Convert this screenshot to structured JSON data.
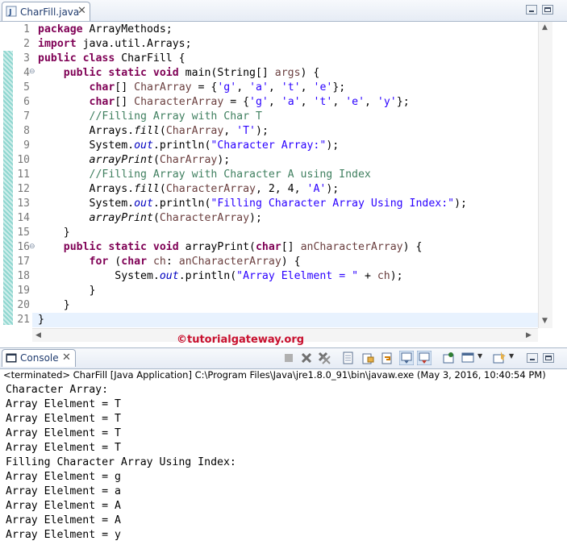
{
  "editor": {
    "tab_label": "CharFill.java",
    "tab_close": "✕",
    "lines": [
      {
        "n": "1",
        "html": "<span class=\"kw\">package</span> ArrayMethods;"
      },
      {
        "n": "2",
        "html": "<span class=\"kw\">import</span> java.util.Arrays;"
      },
      {
        "n": "3",
        "html": "<span class=\"kw\">public class</span> CharFill {"
      },
      {
        "n": "4",
        "html": "    <span class=\"kw\">public static void</span> main(String[] <span class=\"prm\">args</span>) {"
      },
      {
        "n": "5",
        "html": "        <span class=\"kw\">char</span>[] <span class=\"prm\">CharArray</span> = {<span class=\"str\">'g'</span>, <span class=\"str\">'a'</span>, <span class=\"str\">'t'</span>, <span class=\"str\">'e'</span>};"
      },
      {
        "n": "6",
        "html": "        <span class=\"kw\">char</span>[] <span class=\"prm\">CharacterArray</span> = {<span class=\"str\">'g'</span>, <span class=\"str\">'a'</span>, <span class=\"str\">'t'</span>, <span class=\"str\">'e'</span>, <span class=\"str\">'y'</span>};"
      },
      {
        "n": "7",
        "html": "        <span class=\"cmt\">//Filling Array with Char T</span>"
      },
      {
        "n": "8",
        "html": "        Arrays.<span class=\"mit\">fill</span>(<span class=\"prm\">CharArray</span>, <span class=\"str\">'T'</span>);"
      },
      {
        "n": "9",
        "html": "        System.<span class=\"fld\">out</span>.println(<span class=\"str\">\"Character Array:\"</span>);"
      },
      {
        "n": "10",
        "html": "        <span class=\"mit\">arrayPrint</span>(<span class=\"prm\">CharArray</span>);"
      },
      {
        "n": "11",
        "html": "        <span class=\"cmt\">//Filling Array with Character A using Index</span>"
      },
      {
        "n": "12",
        "html": "        Arrays.<span class=\"mit\">fill</span>(<span class=\"prm\">CharacterArray</span>, 2, 4, <span class=\"str\">'A'</span>);"
      },
      {
        "n": "13",
        "html": "        System.<span class=\"fld\">out</span>.println(<span class=\"str\">\"Filling Character Array Using Index:\"</span>);"
      },
      {
        "n": "14",
        "html": "        <span class=\"mit\">arrayPrint</span>(<span class=\"prm\">CharacterArray</span>);"
      },
      {
        "n": "15",
        "html": "    }"
      },
      {
        "n": "16",
        "html": "    <span class=\"kw\">public static void</span> arrayPrint(<span class=\"kw\">char</span>[] <span class=\"prm\">anCharacterArray</span>) {"
      },
      {
        "n": "17",
        "html": "        <span class=\"kw\">for</span> (<span class=\"kw\">char</span> <span class=\"prm\">ch</span>: <span class=\"prm\">anCharacterArray</span>) {"
      },
      {
        "n": "18",
        "html": "            System.<span class=\"fld\">out</span>.println(<span class=\"str\">\"Array Elelment = \"</span> + <span class=\"prm\">ch</span>);"
      },
      {
        "n": "19",
        "html": "        }"
      },
      {
        "n": "20",
        "html": "    }"
      },
      {
        "n": "21",
        "html": "}"
      }
    ]
  },
  "watermark": "©tutorialgateway.org",
  "console": {
    "tab_label": "Console",
    "tab_close": "✕",
    "status": "<terminated> CharFill [Java Application] C:\\Program Files\\Java\\jre1.8.0_91\\bin\\javaw.exe (May 3, 2016, 10:40:54 PM)",
    "output": [
      "Character Array:",
      "Array Elelment = T",
      "Array Elelment = T",
      "Array Elelment = T",
      "Array Elelment = T",
      "Filling Character Array Using Index:",
      "Array Elelment = g",
      "Array Elelment = a",
      "Array Elelment = A",
      "Array Elelment = A",
      "Array Elelment = y"
    ]
  },
  "colors": {
    "keyword": "#7f0055",
    "string": "#2a00ff",
    "comment": "#3f7f5f",
    "field": "#0000c0",
    "watermark": "#c8102e"
  }
}
